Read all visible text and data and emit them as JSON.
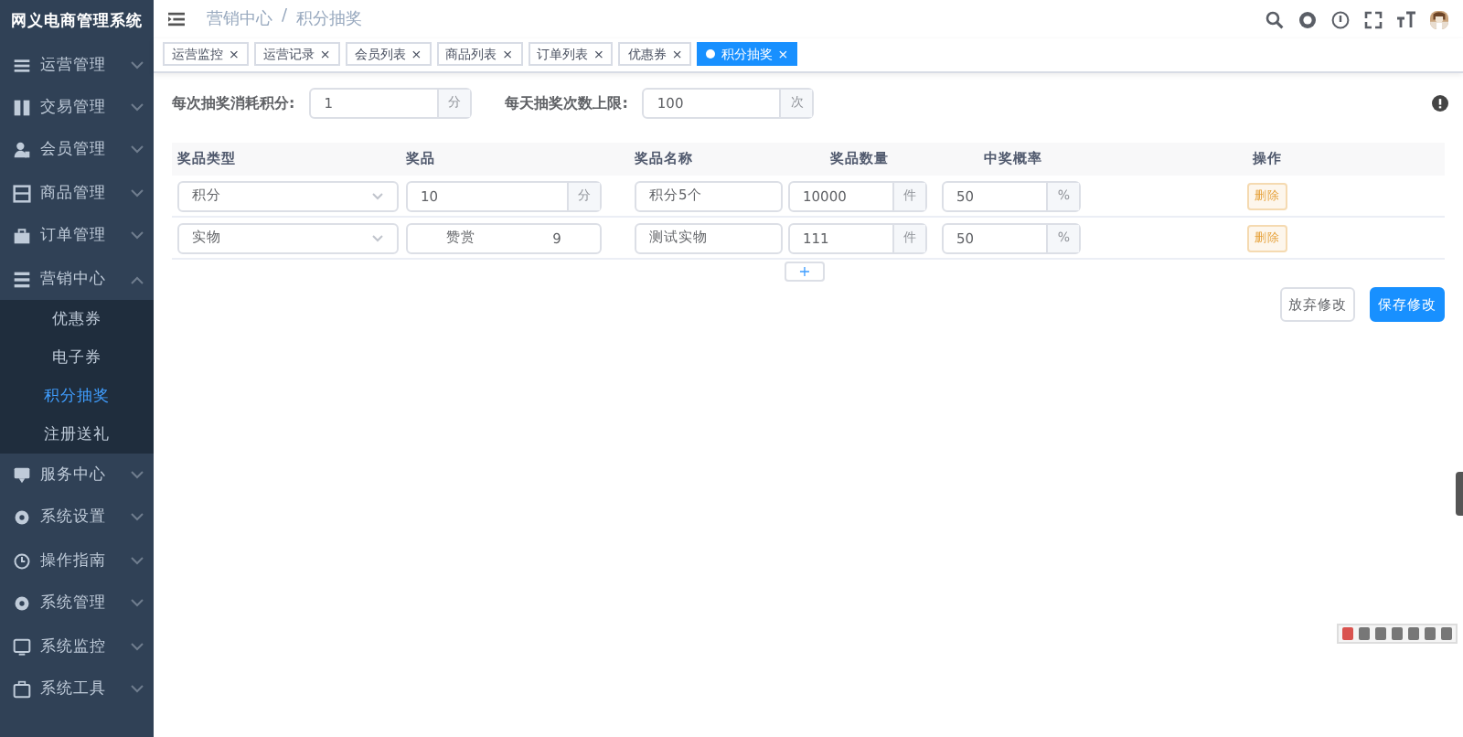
{
  "sidebar": {
    "title": "网义电商管理系统",
    "items": [
      {
        "label": "运营管理",
        "expanded": false
      },
      {
        "label": "交易管理",
        "expanded": false
      },
      {
        "label": "会员管理",
        "expanded": false
      },
      {
        "label": "商品管理",
        "expanded": false
      },
      {
        "label": "订单管理",
        "expanded": false
      },
      {
        "label": "营销中心",
        "expanded": true,
        "children": [
          {
            "label": "优惠券",
            "selected": false
          },
          {
            "label": "电子券",
            "selected": false
          },
          {
            "label": "积分抽奖",
            "selected": true
          },
          {
            "label": "注册送礼",
            "selected": false
          }
        ]
      },
      {
        "label": "服务中心",
        "expanded": false
      },
      {
        "label": "系统设置",
        "expanded": false
      },
      {
        "label": "操作指南",
        "expanded": false
      },
      {
        "label": "系统管理",
        "expanded": false
      },
      {
        "label": "系统监控",
        "expanded": false
      },
      {
        "label": "系统工具",
        "expanded": false
      }
    ]
  },
  "breadcrumb": [
    "营销中心",
    "/",
    "积分抽奖"
  ],
  "tabs": [
    {
      "label": "运营监控",
      "close": "×",
      "selected": false
    },
    {
      "label": "运营记录",
      "close": "×",
      "selected": false
    },
    {
      "label": "会员列表",
      "close": "×",
      "selected": false
    },
    {
      "label": "商品列表",
      "close": "×",
      "selected": false
    },
    {
      "label": "订单列表",
      "close": "×",
      "selected": false
    },
    {
      "label": "优惠券",
      "close": "×",
      "selected": false
    },
    {
      "label": "积分抽奖",
      "close": "×",
      "selected": true
    }
  ],
  "settings": [
    {
      "label": "每次抽奖消耗积分:",
      "value": "1",
      "unit": "分"
    },
    {
      "label": "每天抽奖次数上限:",
      "value": "100",
      "unit": "次"
    }
  ],
  "table": {
    "columns": [
      "奖品类型",
      "奖品",
      "奖品名称",
      "奖品数量",
      "中奖概率",
      "操作"
    ],
    "rows": [
      {
        "type": "积分",
        "prize": {
          "kind": "input",
          "value": "10",
          "unit": "分"
        },
        "name": "积分5个",
        "quantity": "10000",
        "quantity_unit": "件",
        "probability": "50",
        "probability_unit": "%",
        "action": "删除"
      },
      {
        "type": "实物",
        "prize": {
          "kind": "text",
          "value": "赞赏",
          "extra": "9"
        },
        "name": "测试实物",
        "quantity": "111",
        "quantity_unit": "件",
        "probability": "50",
        "probability_unit": "%",
        "action": "删除"
      }
    ],
    "add_button": "+"
  },
  "buttons": [
    {
      "label": "放弃修改",
      "kind": "secondary"
    },
    {
      "label": "保存修改",
      "kind": "primary"
    }
  ]
}
